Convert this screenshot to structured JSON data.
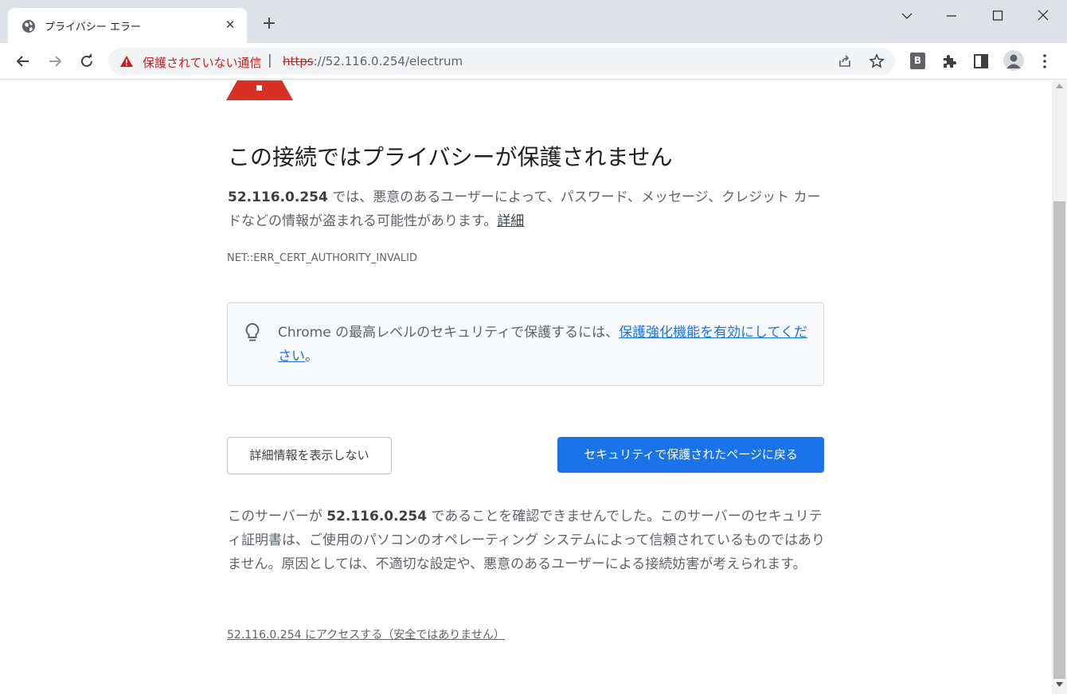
{
  "tab": {
    "title": "プライバシー エラー",
    "close": "✕",
    "new_tab": "+"
  },
  "omnibox": {
    "security_label": "保護されていない通信",
    "separator": "|",
    "url_scheme": "https",
    "url_rest": "://52.116.0.254/electrum"
  },
  "extensions": {
    "b_label": "B"
  },
  "page": {
    "heading": "この接続ではプライバシーが保護されません",
    "p1_host": "52.116.0.254",
    "p1_text": " では、悪意のあるユーザーによって、パスワード、メッセージ、クレジット カードなどの情報が盗まれる可能性があります。",
    "p1_link": "詳細",
    "error_code": "NET::ERR_CERT_AUTHORITY_INVALID",
    "tip_text": "Chrome の最高レベルのセキュリティで保護するには、",
    "tip_link": "保護強化機能を有効にしてください",
    "tip_end": "。",
    "btn_details": "詳細情報を表示しない",
    "btn_back": "セキュリティで保護されたページに戻る",
    "p2_pre": "このサーバーが ",
    "p2_host": "52.116.0.254",
    "p2_text": " であることを確認できませんでした。このサーバーのセキュリティ証明書は、ご使用のパソコンのオペレーティング システムによって信頼されているものではありません。原因としては、不適切な設定や、悪意のあるユーザーによる接続妨害が考えられます。",
    "proceed_link": "52.116.0.254 にアクセスする（安全ではありません）"
  },
  "colors": {
    "accent": "#1a73e8",
    "danger": "#c5221f",
    "warning_icon": "#d93025"
  },
  "icons": [
    "globe-icon",
    "back-icon",
    "forward-icon",
    "reload-icon",
    "warning-icon",
    "share-icon",
    "star-icon",
    "extension-icon",
    "side-panel-icon",
    "profile-icon",
    "menu-icon",
    "lightbulb-icon"
  ]
}
